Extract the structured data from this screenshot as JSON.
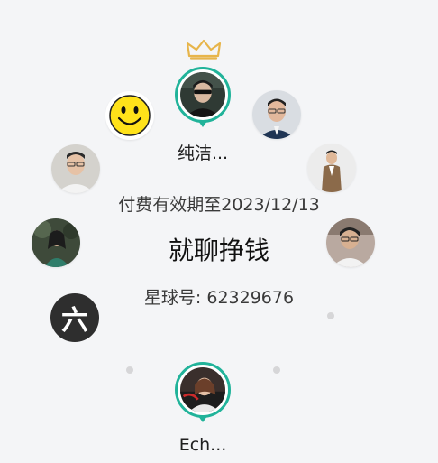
{
  "circle": {
    "featured_top_name": "纯洁...",
    "featured_bottom_name": "Ech...",
    "six_badge": "六"
  },
  "info": {
    "expiry": "付费有效期至2023/12/13",
    "group_name": "就聊挣钱",
    "planet_id": "星球号: 62329676"
  },
  "colors": {
    "accent_ring": "#21b39a",
    "crown": "#e7b54b",
    "background": "#f4f5f7"
  }
}
